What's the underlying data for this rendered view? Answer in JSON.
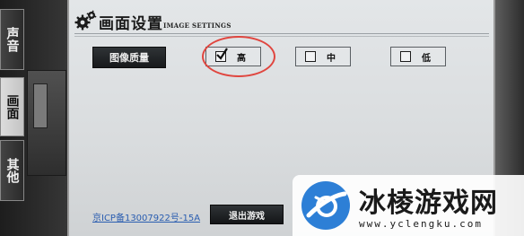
{
  "panel": {
    "title": "画面设置",
    "subtitle": "IMAGE SETTINGS",
    "quality_label": "图像质量",
    "options": [
      {
        "label": "高",
        "checked": true
      },
      {
        "label": "中",
        "checked": false
      },
      {
        "label": "低",
        "checked": false
      }
    ],
    "icp_text": "京ICP备13007922号-15A",
    "exit_label": "退出游戏"
  },
  "tabs": [
    {
      "label": "声音",
      "active": false
    },
    {
      "label": "画面",
      "active": true
    },
    {
      "label": "其他",
      "active": false
    }
  ],
  "watermark": {
    "title": "冰棱游戏网",
    "url": "www.yclengku.com"
  },
  "colors": {
    "annotation": "#e0463f",
    "link": "#2a5db0",
    "watermark_blue": "#2d7fd6"
  },
  "icons": {
    "header": "gear-icon",
    "logo": "watermark-logo-icon"
  }
}
